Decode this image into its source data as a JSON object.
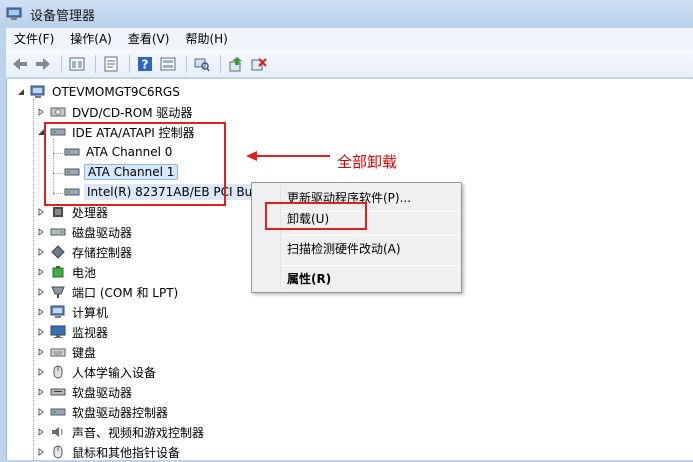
{
  "window": {
    "title": "设备管理器"
  },
  "menubar": [
    "文件(F)",
    "操作(A)",
    "查看(V)",
    "帮助(H)"
  ],
  "toolbar": {
    "buttons": [
      "back-icon",
      "forward-icon",
      "computer-view-icon",
      "properties-icon",
      "help-icon",
      "device-view-icon",
      "scan-icon",
      "update-driver-icon",
      "uninstall-icon"
    ]
  },
  "tree": {
    "root": "OTEVMOMGT9C6RGS",
    "items": [
      "DVD/CD-ROM 驱动器",
      "IDE ATA/ATAPI 控制器",
      "ATA Channel 0",
      "ATA Channel 1",
      "Intel(R) 82371AB/EB PCI Bus",
      "处理器",
      "磁盘驱动器",
      "存储控制器",
      "电池",
      "端口 (COM 和 LPT)",
      "计算机",
      "监视器",
      "键盘",
      "人体学输入设备",
      "软盘驱动器",
      "软盘驱动器控制器",
      "声音、视频和游戏控制器",
      "鼠标和其他指针设备"
    ]
  },
  "annotation": "全部卸载",
  "context_menu": {
    "items": [
      "更新驱动程序软件(P)...",
      "卸载(U)",
      "扫描检测硬件改动(A)",
      "属性(R)"
    ]
  },
  "colors": {
    "highlight_red": "#e02020",
    "selection": "#d6e8fb",
    "titlebar": "#bcd3ec"
  }
}
